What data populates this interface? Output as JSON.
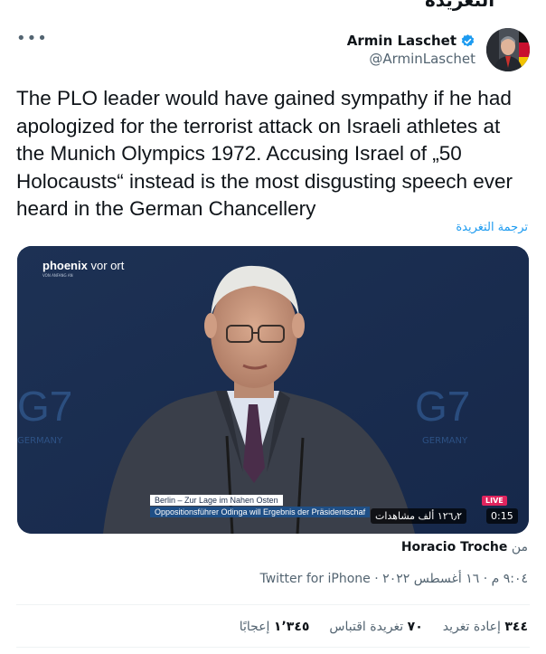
{
  "header": {
    "cut_title": "التغريدة",
    "more_label": "•••"
  },
  "author": {
    "display_name": "Armin Laschet",
    "handle": "@ArminLaschet",
    "verified": true
  },
  "tweet": {
    "text": "The PLO leader would have gained sympathy if he had apologized for the terrorist attack on Israeli athletes at the Munich Olympics 1972. Accusing Israel of „50 Holocausts“ instead is the most disgusting speech ever heard in the German Chancellery",
    "translate_label": "ترجمة التغريدة"
  },
  "media": {
    "channel_brand": "phoenix",
    "channel_suffix": "vor ort",
    "channel_sub": "VON ANFANG AN",
    "g7_left": "G7",
    "g7_right": "G7",
    "germany_left": "GERMANY",
    "germany_right": "GERMANY",
    "lower_third_line1": "Berlin – Zur Lage im Nahen Osten",
    "lower_third_line2": "Oppositionsführer Odinga will Ergebnis der Präsidentschaf",
    "live_badge": "LIVE",
    "views": "١٢٦٫٢ ألف مشاهدات",
    "timer": "0:15"
  },
  "source": {
    "prefix": "من",
    "name": "Horacio Troche"
  },
  "meta": {
    "time": "٩:٠٤ م",
    "separator": "·",
    "date": "١٦ أغسطس ٢٠٢٢",
    "client": "Twitter for iPhone"
  },
  "stats": {
    "retweets_count": "٣٤٤",
    "retweets_label": "إعادة تغريد",
    "quotes_count": "٧٠",
    "quotes_label": "تغريدة اقتباس",
    "likes_count": "١٬٣٤٥",
    "likes_label": "إعجابًا"
  },
  "colors": {
    "accent": "#1d9bf0",
    "secondary_text": "#536471",
    "live_red": "#e0245e"
  }
}
